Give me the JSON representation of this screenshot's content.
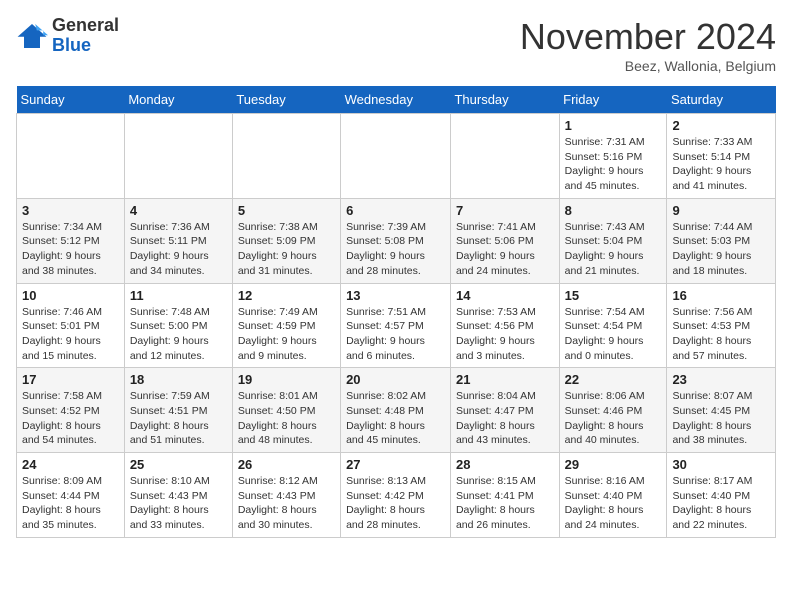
{
  "logo": {
    "general": "General",
    "blue": "Blue"
  },
  "title": "November 2024",
  "location": "Beez, Wallonia, Belgium",
  "days_of_week": [
    "Sunday",
    "Monday",
    "Tuesday",
    "Wednesday",
    "Thursday",
    "Friday",
    "Saturday"
  ],
  "weeks": [
    [
      {
        "day": "",
        "info": ""
      },
      {
        "day": "",
        "info": ""
      },
      {
        "day": "",
        "info": ""
      },
      {
        "day": "",
        "info": ""
      },
      {
        "day": "",
        "info": ""
      },
      {
        "day": "1",
        "info": "Sunrise: 7:31 AM\nSunset: 5:16 PM\nDaylight: 9 hours and 45 minutes."
      },
      {
        "day": "2",
        "info": "Sunrise: 7:33 AM\nSunset: 5:14 PM\nDaylight: 9 hours and 41 minutes."
      }
    ],
    [
      {
        "day": "3",
        "info": "Sunrise: 7:34 AM\nSunset: 5:12 PM\nDaylight: 9 hours and 38 minutes."
      },
      {
        "day": "4",
        "info": "Sunrise: 7:36 AM\nSunset: 5:11 PM\nDaylight: 9 hours and 34 minutes."
      },
      {
        "day": "5",
        "info": "Sunrise: 7:38 AM\nSunset: 5:09 PM\nDaylight: 9 hours and 31 minutes."
      },
      {
        "day": "6",
        "info": "Sunrise: 7:39 AM\nSunset: 5:08 PM\nDaylight: 9 hours and 28 minutes."
      },
      {
        "day": "7",
        "info": "Sunrise: 7:41 AM\nSunset: 5:06 PM\nDaylight: 9 hours and 24 minutes."
      },
      {
        "day": "8",
        "info": "Sunrise: 7:43 AM\nSunset: 5:04 PM\nDaylight: 9 hours and 21 minutes."
      },
      {
        "day": "9",
        "info": "Sunrise: 7:44 AM\nSunset: 5:03 PM\nDaylight: 9 hours and 18 minutes."
      }
    ],
    [
      {
        "day": "10",
        "info": "Sunrise: 7:46 AM\nSunset: 5:01 PM\nDaylight: 9 hours and 15 minutes."
      },
      {
        "day": "11",
        "info": "Sunrise: 7:48 AM\nSunset: 5:00 PM\nDaylight: 9 hours and 12 minutes."
      },
      {
        "day": "12",
        "info": "Sunrise: 7:49 AM\nSunset: 4:59 PM\nDaylight: 9 hours and 9 minutes."
      },
      {
        "day": "13",
        "info": "Sunrise: 7:51 AM\nSunset: 4:57 PM\nDaylight: 9 hours and 6 minutes."
      },
      {
        "day": "14",
        "info": "Sunrise: 7:53 AM\nSunset: 4:56 PM\nDaylight: 9 hours and 3 minutes."
      },
      {
        "day": "15",
        "info": "Sunrise: 7:54 AM\nSunset: 4:54 PM\nDaylight: 9 hours and 0 minutes."
      },
      {
        "day": "16",
        "info": "Sunrise: 7:56 AM\nSunset: 4:53 PM\nDaylight: 8 hours and 57 minutes."
      }
    ],
    [
      {
        "day": "17",
        "info": "Sunrise: 7:58 AM\nSunset: 4:52 PM\nDaylight: 8 hours and 54 minutes."
      },
      {
        "day": "18",
        "info": "Sunrise: 7:59 AM\nSunset: 4:51 PM\nDaylight: 8 hours and 51 minutes."
      },
      {
        "day": "19",
        "info": "Sunrise: 8:01 AM\nSunset: 4:50 PM\nDaylight: 8 hours and 48 minutes."
      },
      {
        "day": "20",
        "info": "Sunrise: 8:02 AM\nSunset: 4:48 PM\nDaylight: 8 hours and 45 minutes."
      },
      {
        "day": "21",
        "info": "Sunrise: 8:04 AM\nSunset: 4:47 PM\nDaylight: 8 hours and 43 minutes."
      },
      {
        "day": "22",
        "info": "Sunrise: 8:06 AM\nSunset: 4:46 PM\nDaylight: 8 hours and 40 minutes."
      },
      {
        "day": "23",
        "info": "Sunrise: 8:07 AM\nSunset: 4:45 PM\nDaylight: 8 hours and 38 minutes."
      }
    ],
    [
      {
        "day": "24",
        "info": "Sunrise: 8:09 AM\nSunset: 4:44 PM\nDaylight: 8 hours and 35 minutes."
      },
      {
        "day": "25",
        "info": "Sunrise: 8:10 AM\nSunset: 4:43 PM\nDaylight: 8 hours and 33 minutes."
      },
      {
        "day": "26",
        "info": "Sunrise: 8:12 AM\nSunset: 4:43 PM\nDaylight: 8 hours and 30 minutes."
      },
      {
        "day": "27",
        "info": "Sunrise: 8:13 AM\nSunset: 4:42 PM\nDaylight: 8 hours and 28 minutes."
      },
      {
        "day": "28",
        "info": "Sunrise: 8:15 AM\nSunset: 4:41 PM\nDaylight: 8 hours and 26 minutes."
      },
      {
        "day": "29",
        "info": "Sunrise: 8:16 AM\nSunset: 4:40 PM\nDaylight: 8 hours and 24 minutes."
      },
      {
        "day": "30",
        "info": "Sunrise: 8:17 AM\nSunset: 4:40 PM\nDaylight: 8 hours and 22 minutes."
      }
    ]
  ]
}
